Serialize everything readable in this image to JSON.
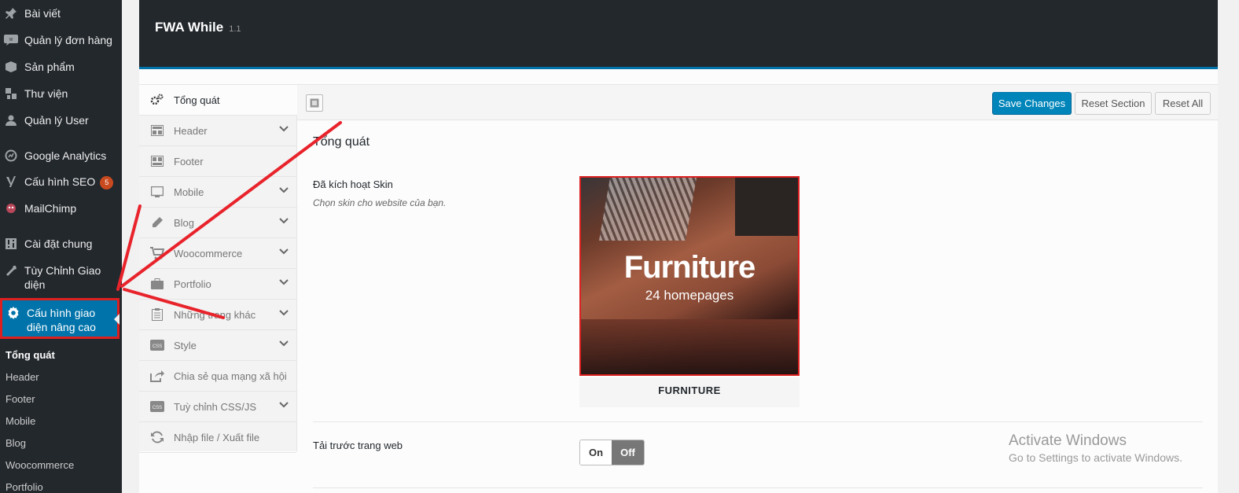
{
  "menu": {
    "items": [
      {
        "label": "Bài viết",
        "icon": "pushpin-icon"
      },
      {
        "label": "Quản lý đơn hàng",
        "icon": "woo-icon"
      },
      {
        "label": "Sản phẩm",
        "icon": "box-icon"
      },
      {
        "label": "Thư viện",
        "icon": "media-icon"
      },
      {
        "label": "Quản lý User",
        "icon": "user-icon"
      },
      {
        "label": "Google Analytics",
        "icon": "analytics-icon"
      },
      {
        "label": "Cấu hình SEO",
        "icon": "yoast-icon",
        "badge": "5"
      },
      {
        "label": "MailChimp",
        "icon": "mailchimp-icon"
      },
      {
        "label": "Cài đặt chung",
        "icon": "settings-sliders-icon"
      },
      {
        "label": "Tùy Chỉnh Giao diện",
        "icon": "wrench-icon"
      },
      {
        "label": "Cấu hình giao diện nâng cao",
        "icon": "gear-icon"
      }
    ],
    "submenu": [
      "Tổng quát",
      "Header",
      "Footer",
      "Mobile",
      "Blog",
      "Woocommerce",
      "Portfolio"
    ]
  },
  "panel": {
    "title": "FWA While",
    "version": "1.1"
  },
  "tabs": [
    {
      "label": "Tổng quát",
      "icon": "gears-icon"
    },
    {
      "label": "Header",
      "icon": "layout-header-icon"
    },
    {
      "label": "Footer",
      "icon": "layout-footer-icon"
    },
    {
      "label": "Mobile",
      "icon": "monitor-icon"
    },
    {
      "label": "Blog",
      "icon": "pencil-icon"
    },
    {
      "label": "Woocommerce",
      "icon": "cart-icon"
    },
    {
      "label": "Portfolio",
      "icon": "briefcase-icon"
    },
    {
      "label": "Những trang khác",
      "icon": "clipboard-icon"
    },
    {
      "label": "Style",
      "icon": "css-icon"
    },
    {
      "label": "Chia sẻ qua mạng xã hội",
      "icon": "share-icon"
    },
    {
      "label": "Tuỳ chỉnh CSS/JS",
      "icon": "css-icon"
    },
    {
      "label": "Nhập file / Xuất file",
      "icon": "refresh-icon"
    }
  ],
  "toolbar": {
    "save": "Save Changes",
    "reset_section": "Reset Section",
    "reset_all": "Reset All"
  },
  "section": {
    "title": "Tổng quát",
    "skin_label": "Đã kích hoạt Skin",
    "skin_desc": "Chọn skin cho website của bạn.",
    "skin_title": "Furniture",
    "skin_sub": "24 homepages",
    "skin_caption": "FURNITURE",
    "preload_label": "Tải trước trang web",
    "switch_on": "On",
    "switch_off": "Off"
  },
  "watermark": {
    "title": "Activate Windows",
    "sub": "Go to Settings to activate Windows."
  },
  "colors": {
    "admin_bg": "#23282d",
    "accent": "#0073aa",
    "highlight_red": "#dc1f1f"
  }
}
